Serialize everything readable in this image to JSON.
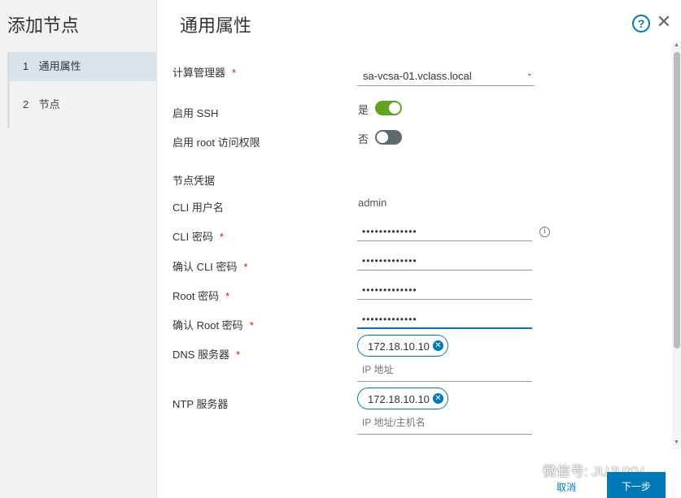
{
  "wizard": {
    "title": "添加节点",
    "steps": [
      {
        "num": "1",
        "label": "通用属性"
      },
      {
        "num": "2",
        "label": "节点"
      }
    ]
  },
  "page": {
    "title": "通用属性",
    "help_icon": "?",
    "close_icon": "✕"
  },
  "form": {
    "compute_manager": {
      "label": "计算管理器",
      "required": "*",
      "value": "sa-vcsa-01.vclass.local"
    },
    "enable_ssh": {
      "label": "启用 SSH",
      "state_text": "是",
      "enabled": true
    },
    "enable_root": {
      "label": "启用 root 访问权限",
      "state_text": "否",
      "enabled": false
    },
    "section_label": "节点凭据",
    "cli_username": {
      "label": "CLI 用户名",
      "value": "admin"
    },
    "cli_password": {
      "label": "CLI 密码",
      "required": "*",
      "value": "•••••••••••••"
    },
    "confirm_cli_password": {
      "label": "确认 CLI 密码",
      "required": "*",
      "value": "•••••••••••••"
    },
    "root_password": {
      "label": "Root 密码",
      "required": "*",
      "value": "•••••••••••••"
    },
    "confirm_root_password": {
      "label": "确认 Root 密码",
      "required": "*",
      "value": "•••••••••••••"
    },
    "dns_servers": {
      "label": "DNS 服务器",
      "required": "*",
      "chip": "172.18.10.10",
      "placeholder": "IP 地址"
    },
    "ntp_servers": {
      "label": "NTP 服务器",
      "chip": "172.18.10.10",
      "placeholder": "IP 地址/主机名"
    }
  },
  "footer": {
    "cancel_label": "取消",
    "next_label": "下一步",
    "watermark": "微信号: JUJUXV"
  },
  "colors": {
    "accent": "#0079b8",
    "toggle_on": "#62a420",
    "required": "#c92100"
  }
}
